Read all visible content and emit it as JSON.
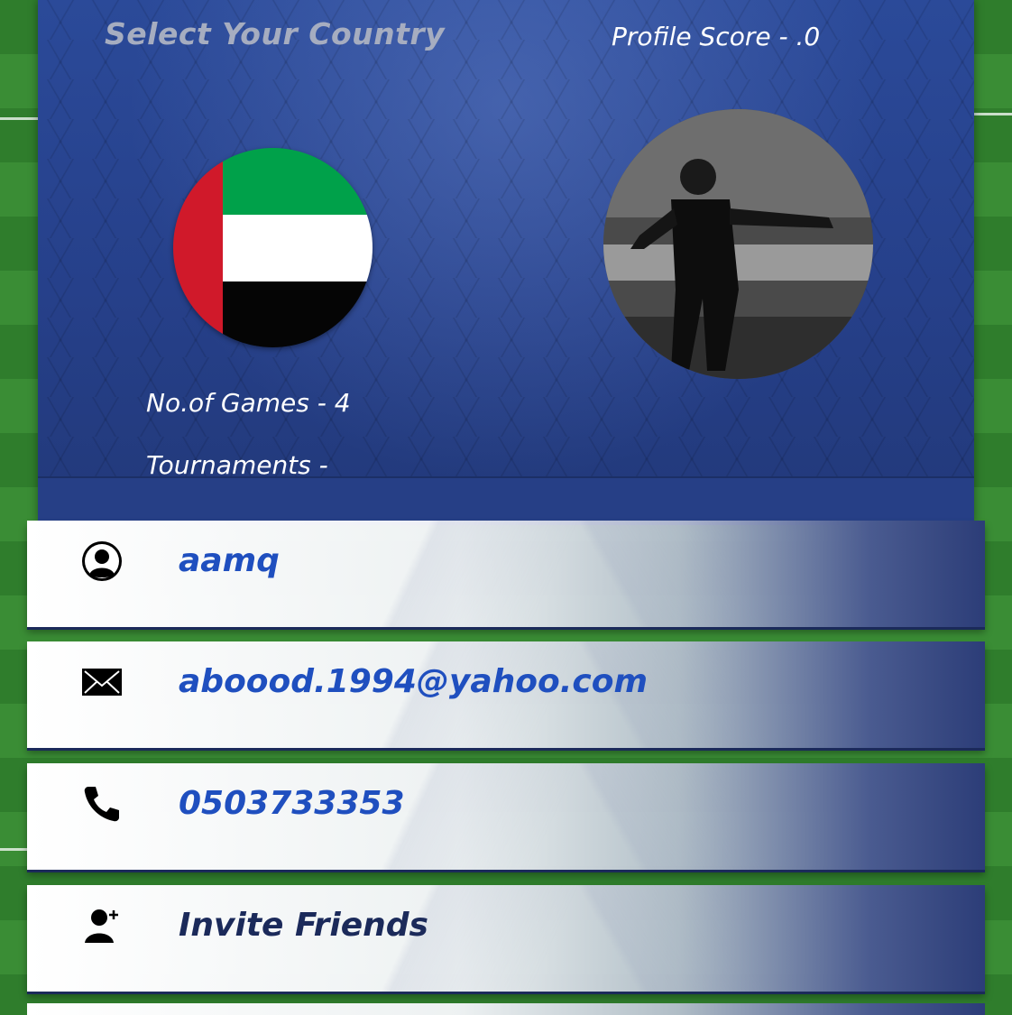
{
  "header": {
    "select_country": "Select Your Country",
    "profile_score": "Profile Score - .0"
  },
  "country": {
    "flag_colors": {
      "red": "#d0192a",
      "green": "#00a14a",
      "white": "#ffffff",
      "black": "#050505"
    }
  },
  "stats": {
    "games": "No.of Games - 4",
    "tournaments": "Tournaments -"
  },
  "rows": [
    {
      "label": "aamq",
      "icon": "user-icon",
      "color": "#1f4fbf"
    },
    {
      "label": "aboood.1994@yahoo.com",
      "icon": "mail-icon",
      "color": "#1f4fbf"
    },
    {
      "label": "0503733353",
      "icon": "phone-icon",
      "color": "#1f4fbf"
    },
    {
      "label": "Invite Friends",
      "icon": "add-user-icon",
      "color": "#1b2a5a"
    }
  ]
}
